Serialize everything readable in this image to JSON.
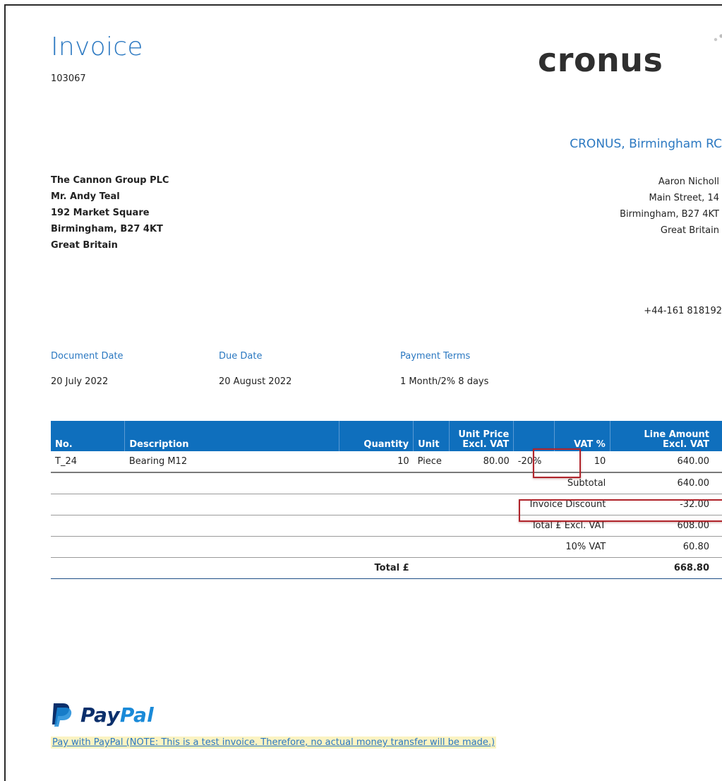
{
  "document": {
    "title": "Invoice",
    "number": "103067"
  },
  "logo": {
    "text": "cronus",
    "icon": "cronus-dots-icon"
  },
  "company": {
    "name": "CRONUS, Birmingham RC",
    "lines": [
      "Aaron Nicholl",
      "Main Street, 14",
      "Birmingham, B27 4KT",
      "Great Britain"
    ],
    "phone": "+44-161 818192"
  },
  "customer": {
    "lines": [
      "The Cannon Group PLC",
      "Mr. Andy Teal",
      "192 Market Square",
      "Birmingham, B27 4KT",
      "Great Britain"
    ]
  },
  "meta": {
    "document_date_label": "Document Date",
    "document_date": "20 July 2022",
    "due_date_label": "Due Date",
    "due_date": "20 August 2022",
    "payment_terms_label": "Payment Terms",
    "payment_terms": "1 Month/2% 8 days"
  },
  "table": {
    "headers": {
      "no": "No.",
      "description": "Description",
      "quantity": "Quantity",
      "unit": "Unit",
      "unit_price_1": "Unit Price",
      "unit_price_2": "Excl. VAT",
      "vat": "VAT %",
      "line_amount_1": "Line Amount",
      "line_amount_2": "Excl. VAT"
    },
    "rows": [
      {
        "no": "T_24",
        "description": "Bearing M12",
        "quantity": "10",
        "unit": "Piece",
        "unit_price": "80.00",
        "discount": "-20%",
        "vat": "10",
        "line_amount": "640.00"
      }
    ],
    "totals": [
      {
        "label": "Subtotal",
        "value": "640.00"
      },
      {
        "label": "Invoice Discount",
        "value": "-32.00"
      },
      {
        "label": "Total £ Excl. VAT",
        "value": "608.00"
      },
      {
        "label": "10% VAT",
        "value": "60.80"
      }
    ],
    "grand_total": {
      "label": "Total £",
      "value": "668.80"
    }
  },
  "paypal": {
    "icon": "paypal-p-icon",
    "word_pay": "Pay",
    "word_pal": "Pal",
    "link_text": "Pay with PayPal (NOTE: This is a test invoice. Therefore, no actual money transfer will be made.)",
    "colors": {
      "dark": "#0b2f6b",
      "light": "#1a8ad8"
    }
  },
  "colors": {
    "accent": "#2b78c1",
    "table_header": "#0f6fbd",
    "highlight_box": "#b0242b"
  }
}
